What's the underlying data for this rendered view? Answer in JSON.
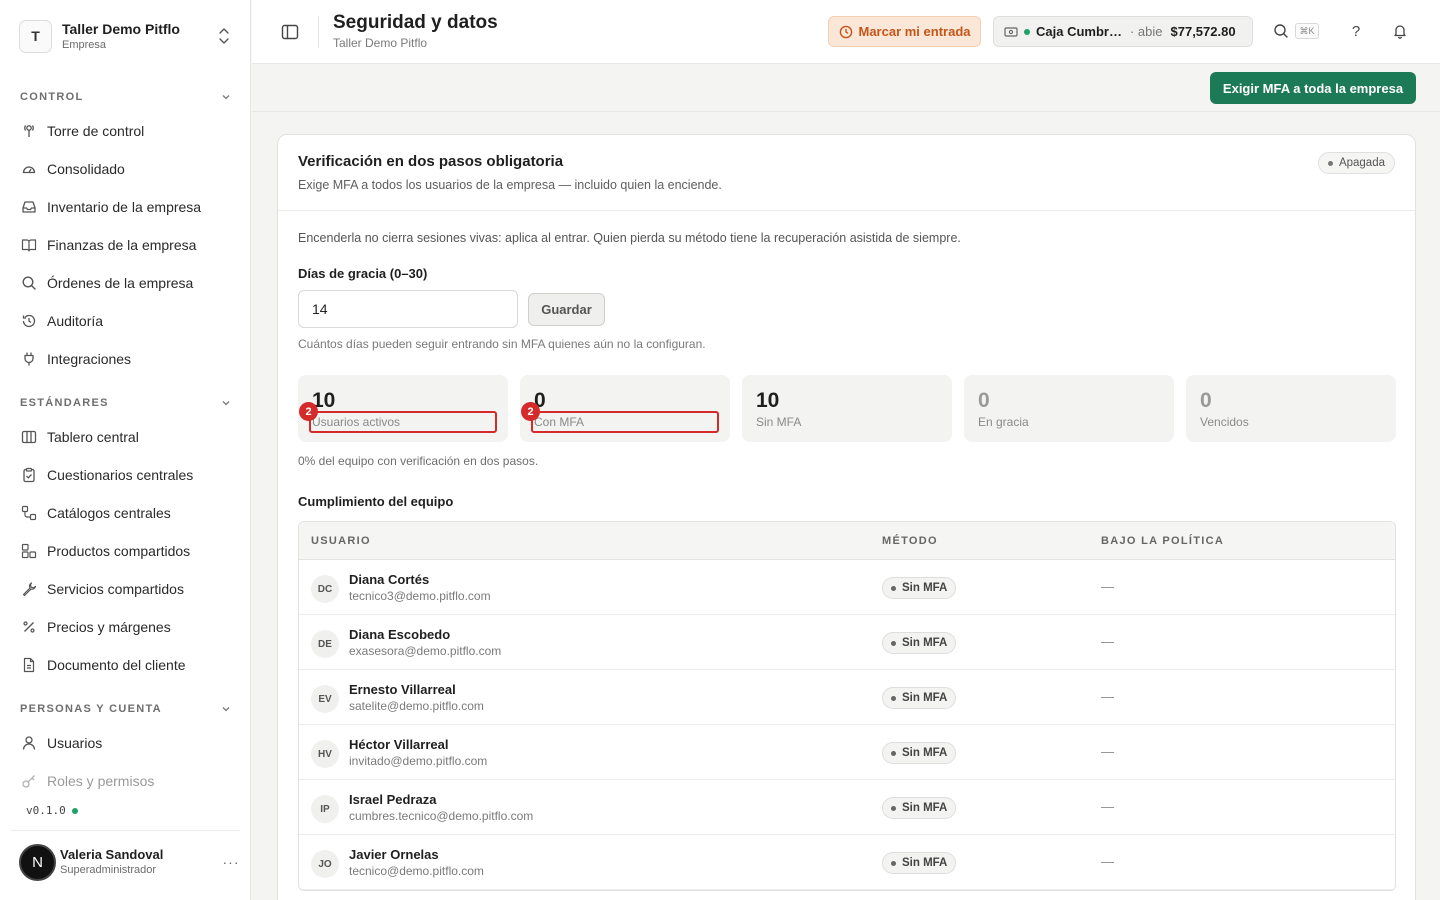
{
  "workspace": {
    "initial": "T",
    "name": "Taller Demo Pitflo",
    "type": "Empresa"
  },
  "sidebar": {
    "sections": [
      {
        "label": "CONTROL",
        "items": [
          {
            "label": "Torre de control",
            "icon": "tower-icon"
          },
          {
            "label": "Consolidado",
            "icon": "gauge-icon"
          },
          {
            "label": "Inventario de la empresa",
            "icon": "inbox-icon"
          },
          {
            "label": "Finanzas de la empresa",
            "icon": "book-icon"
          },
          {
            "label": "Órdenes de la empresa",
            "icon": "search-icon"
          },
          {
            "label": "Auditoría",
            "icon": "history-icon"
          },
          {
            "label": "Integraciones",
            "icon": "plug-icon"
          }
        ]
      },
      {
        "label": "ESTÁNDARES",
        "items": [
          {
            "label": "Tablero central",
            "icon": "columns-icon"
          },
          {
            "label": "Cuestionarios centrales",
            "icon": "clipboard-icon"
          },
          {
            "label": "Catálogos centrales",
            "icon": "workflow-icon"
          },
          {
            "label": "Productos compartidos",
            "icon": "boxes-icon"
          },
          {
            "label": "Servicios compartidos",
            "icon": "wrench-icon"
          },
          {
            "label": "Precios y márgenes",
            "icon": "percent-icon"
          },
          {
            "label": "Documento del cliente",
            "icon": "file-icon"
          }
        ]
      },
      {
        "label": "PERSONAS Y CUENTA",
        "items": [
          {
            "label": "Usuarios",
            "icon": "user-icon"
          },
          {
            "label": "Roles y permisos",
            "icon": "key-icon"
          }
        ]
      }
    ],
    "version": "v0.1.0"
  },
  "current_user": {
    "initial": "N",
    "name": "Valeria Sandoval",
    "role": "Superadministrador",
    "more": "···"
  },
  "header": {
    "title": "Seguridad y datos",
    "subtitle": "Taller Demo Pitflo",
    "clock_in_label": "Marcar mi entrada",
    "register_name": "Caja Cumbr…",
    "register_state": "· abie",
    "register_amount": "$77,572.80",
    "shortcut": "⌘K",
    "help": "?"
  },
  "action_bar": {
    "primary_label": "Exigir MFA a toda la empresa"
  },
  "mfa_card": {
    "title": "Verificación en dos pasos obligatoria",
    "description": "Exige MFA a todos los usuarios de la empresa — incluido quien la enciende.",
    "status": "Apagada",
    "info": "Encenderla no cierra sesiones vivas: aplica al entrar. Quien pierda su método tiene la recuperación asistida de siempre.",
    "grace_label": "Días de gracia (0–30)",
    "grace_value": "14",
    "save_label": "Guardar",
    "grace_help": "Cuántos días pueden seguir entrando sin MFA quienes aún no la configuran.",
    "stats": [
      {
        "value": "10",
        "label": "Usuarios activos",
        "badge": "2"
      },
      {
        "value": "0",
        "label": "Con MFA",
        "badge": "2"
      },
      {
        "value": "10",
        "label": "Sin MFA"
      },
      {
        "value": "0",
        "label": "En gracia"
      },
      {
        "value": "0",
        "label": "Vencidos"
      }
    ],
    "coverage_text": "0% del equipo con verificación en dos pasos.",
    "team_title": "Cumplimiento del equipo"
  },
  "table": {
    "headers": {
      "user": "USUARIO",
      "method": "MÉTODO",
      "policy": "BAJO LA POLÍTICA"
    },
    "rows": [
      {
        "initials": "DC",
        "name": "Diana Cortés",
        "email": "tecnico3@demo.pitflo.com",
        "method": "Sin MFA",
        "policy": "—"
      },
      {
        "initials": "DE",
        "name": "Diana Escobedo",
        "email": "exasesora@demo.pitflo.com",
        "method": "Sin MFA",
        "policy": "—"
      },
      {
        "initials": "EV",
        "name": "Ernesto Villarreal",
        "email": "satelite@demo.pitflo.com",
        "method": "Sin MFA",
        "policy": "—"
      },
      {
        "initials": "HV",
        "name": "Héctor Villarreal",
        "email": "invitado@demo.pitflo.com",
        "method": "Sin MFA",
        "policy": "—"
      },
      {
        "initials": "IP",
        "name": "Israel Pedraza",
        "email": "cumbres.tecnico@demo.pitflo.com",
        "method": "Sin MFA",
        "policy": "—"
      },
      {
        "initials": "JO",
        "name": "Javier Ornelas",
        "email": "tecnico@demo.pitflo.com",
        "method": "Sin MFA",
        "policy": "—"
      }
    ]
  },
  "colors": {
    "primary": "#1d7a56",
    "clock_in_bg": "#fbe7d8",
    "clock_in_text": "#c4561a",
    "highlight": "#d42a2a",
    "online": "#1aa367"
  }
}
